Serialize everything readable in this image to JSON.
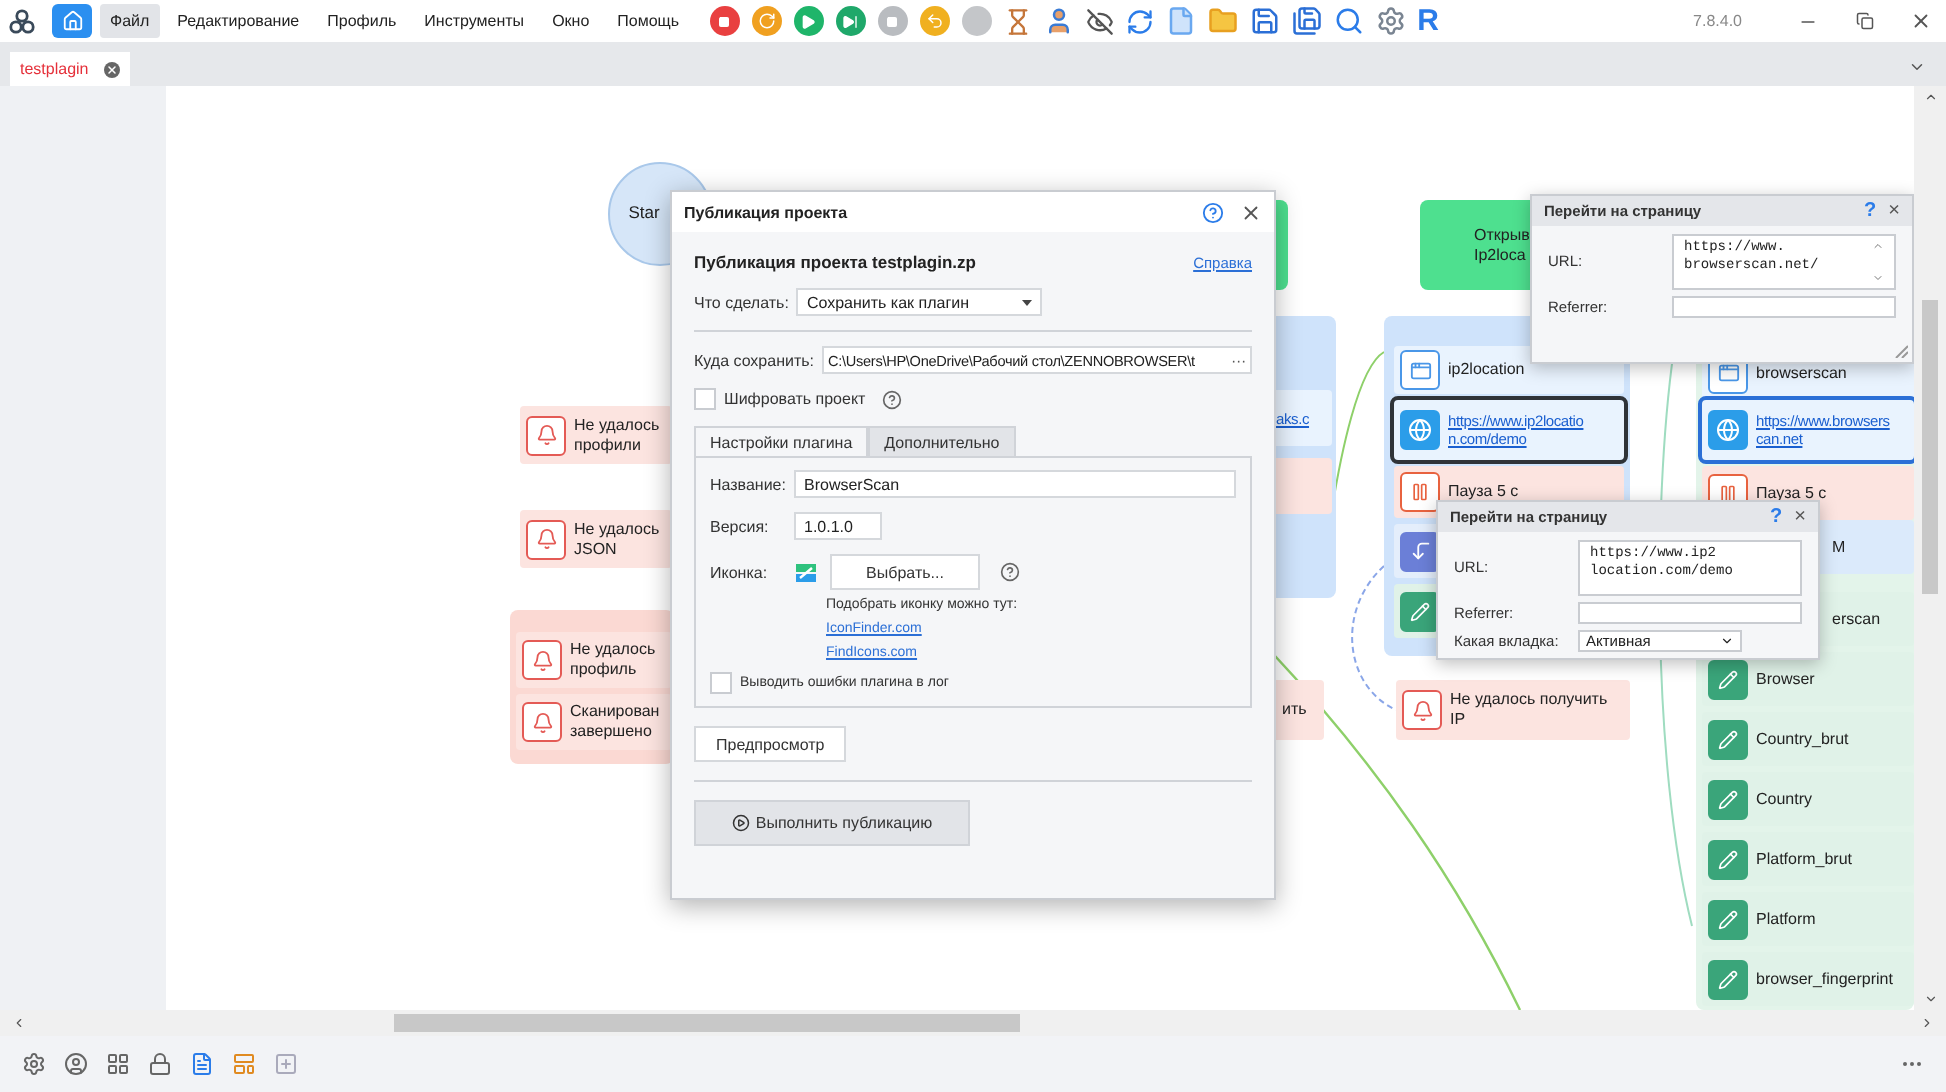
{
  "menu": [
    {
      "label": "Файл",
      "selected": true
    },
    {
      "label": "Редактирование",
      "selected": false
    },
    {
      "label": "Профиль",
      "selected": false
    },
    {
      "label": "Инструменты",
      "selected": false
    },
    {
      "label": "Окно",
      "selected": false
    },
    {
      "label": "Помощь",
      "selected": false
    }
  ],
  "toolbar_letter": "R",
  "version": "7.8.4.0",
  "tabs": [
    {
      "label": "testplagin",
      "selected": true
    }
  ],
  "canvas": {
    "start": {
      "label": "Star"
    },
    "left_alerts": [
      {
        "kind": "alert",
        "lines": [
          "Не удалось",
          "профили"
        ]
      },
      {
        "kind": "alert",
        "lines": [
          "Не удалось",
          "JSON"
        ]
      }
    ],
    "left_group": [
      {
        "kind": "alert",
        "lines": [
          "Не удалось",
          "профиль"
        ]
      },
      {
        "kind": "alert",
        "lines": [
          "Сканирован",
          "завершено"
        ]
      }
    ],
    "hidden_group": {
      "link": "aks.c",
      "alert_tail": "ить"
    },
    "ip_block": {
      "lines": [
        "Открыв",
        "Ip2loca"
      ]
    },
    "ip_group": [
      {
        "kind": "browser",
        "lines": [
          "ip2location"
        ],
        "selected": false
      },
      {
        "kind": "link",
        "lines": [
          "https://www.ip2locatio",
          "n.com/demo"
        ],
        "selected": true
      },
      {
        "kind": "pause",
        "lines": [
          "Пауза 5 с"
        ],
        "selected": false
      },
      {
        "kind": "jump",
        "selected": false
      },
      {
        "kind": "edit",
        "selected": false
      }
    ],
    "ip_alert": {
      "kind": "alert",
      "lines": [
        "Не удалось получить",
        "IP"
      ]
    },
    "scan_group": [
      {
        "kind": "browser",
        "lines": [
          "browserscan"
        ],
        "selected": false
      },
      {
        "kind": "link",
        "lines": [
          "https://www.browsers",
          "can.net"
        ],
        "selected": true
      },
      {
        "kind": "pause",
        "lines": [
          "Пауза 5 с"
        ],
        "selected": false
      },
      {
        "kind": "covered",
        "lines": [
          "M"
        ],
        "selected": false
      },
      {
        "kind": "covered",
        "lines": [
          "erscan"
        ],
        "selected": false
      },
      {
        "kind": "edit",
        "lines": [
          "Browser"
        ],
        "selected": false
      },
      {
        "kind": "edit",
        "lines": [
          "Country_brut"
        ],
        "selected": false
      },
      {
        "kind": "edit",
        "lines": [
          "Country"
        ],
        "selected": false
      },
      {
        "kind": "edit",
        "lines": [
          "Platform_brut"
        ],
        "selected": false
      },
      {
        "kind": "edit",
        "lines": [
          "Platform"
        ],
        "selected": false
      },
      {
        "kind": "edit",
        "lines": [
          "browser_fingerprint"
        ],
        "selected": false
      }
    ]
  },
  "page_dialogs": [
    {
      "title": "Перейти на страницу",
      "help": "?",
      "close": "×",
      "url_label": "URL:",
      "url_lines": [
        "https://www.",
        "browserscan.net/"
      ],
      "referrer_label": "Referrer:"
    },
    {
      "title": "Перейти на страницу",
      "help": "?",
      "close": "×",
      "url_label": "URL:",
      "url_lines": [
        "https://www.ip2",
        "location.com/demo"
      ],
      "referrer_label": "Referrer:",
      "tab_label": "Какая вкладка:",
      "tab_value": "Активная"
    }
  ],
  "publish_dialog": {
    "title": "Публикация проекта",
    "heading": "Публикация проекта  testplagin.zp",
    "help_link": "Справка",
    "action_label": "Что сделать:",
    "action_value": "Сохранить как плагин",
    "path_label": "Куда сохранить:",
    "path_value": "C:\\Users\\HP\\OneDrive\\Рабочий стол\\ZENNOBROWSER\\t",
    "path_button": "···",
    "encrypt": {
      "label": "Шифровать проект",
      "checked": false
    },
    "tabs": [
      {
        "label": "Настройки плагина",
        "selected": true
      },
      {
        "label": "Дополнительно",
        "selected": false
      }
    ],
    "name_label": "Название:",
    "name_value": "BrowserScan",
    "version_label": "Версия:",
    "version_value": "1.0.1.0",
    "icon_label": "Иконка:",
    "choose_button": "Выбрать...",
    "icon_hint": "Подобрать иконку можно тут:",
    "links": [
      "IconFinder.com",
      "FindIcons.com"
    ],
    "log_errors": {
      "label": "Выводить ошибки плагина в лог",
      "checked": false
    },
    "preview_button": "Предпросмотр",
    "publish_button": "Выполнить публикацию"
  }
}
